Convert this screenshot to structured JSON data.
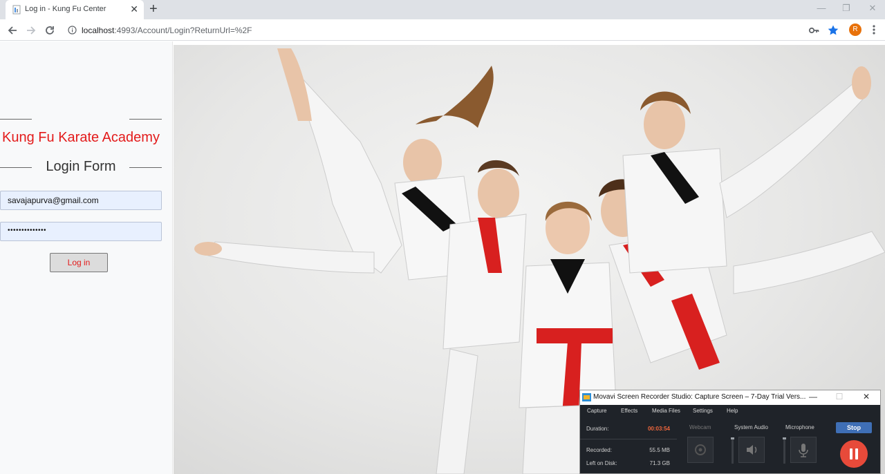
{
  "browser": {
    "tab_title": "Log in - Kung Fu Center",
    "tab_close": "✕",
    "new_tab": "+",
    "url_host": "localhost",
    "url_rest": ":4993/Account/Login?ReturnUrl=%2F",
    "profile_initial": "R",
    "window_controls": {
      "minimize": "—",
      "maximize": "❐",
      "close": "✕"
    },
    "accent": "#1a73e8"
  },
  "login": {
    "academy_title": "Kung Fu Karate Academy",
    "form_title": "Login Form",
    "email_value": "savajapurva@gmail.com",
    "password_value": "••••••••••••••",
    "login_button": "Log in",
    "title_color": "#e31b1b"
  },
  "hero": {
    "image": "karate-kids-photo"
  },
  "recorder": {
    "title": "Movavi Screen Recorder Studio: Capture Screen – 7-Day Trial Vers...",
    "window_controls": {
      "minimize": "—",
      "maximize": "☐",
      "close": "✕"
    },
    "menu": [
      "Capture",
      "Effects",
      "Media Files",
      "Settings",
      "Help"
    ],
    "duration_label": "Duration:",
    "duration_value": "00:03:54",
    "recorded_label": "Recorded:",
    "recorded_value": "55.5 MB",
    "disk_label": "Left on Disk:",
    "disk_value": "71.3 GB",
    "webcam_label": "Webcam",
    "system_audio_label": "System Audio",
    "microphone_label": "Microphone",
    "stop_label": "Stop",
    "duration_color": "#f0663c",
    "stop_color": "#3f6fb6",
    "pause_color": "#e74a3a"
  }
}
